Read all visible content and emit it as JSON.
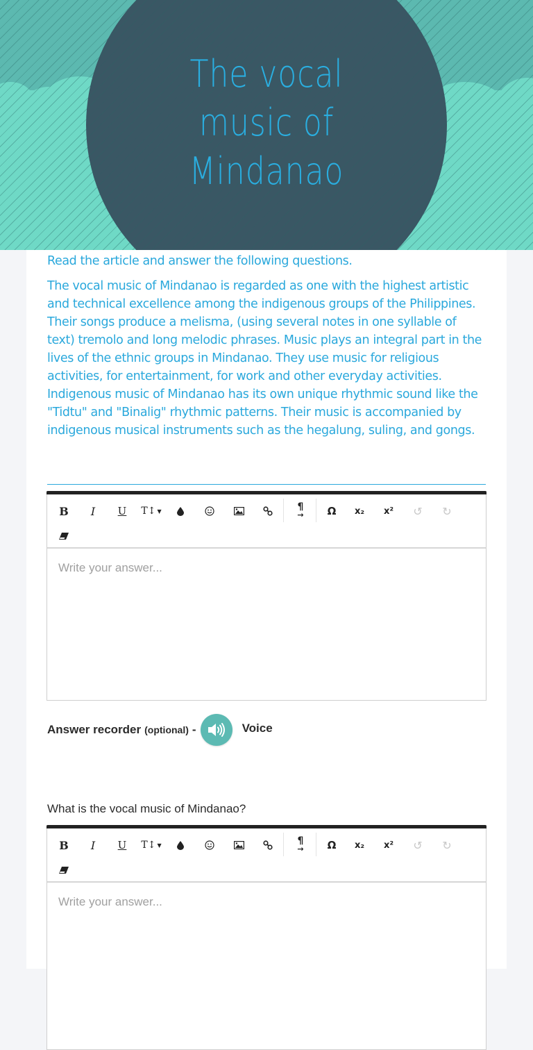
{
  "header": {
    "title_lines": [
      "The vocal",
      "music of",
      "Mindanao"
    ]
  },
  "colors": {
    "banner_teal": "#5cb9b0",
    "cloud_teal": "#6fd9c6",
    "circle_dark": "#3a5764",
    "accent_blue": "#2aa8dc",
    "voice_button": "#5cbab3"
  },
  "instructions": {
    "lead": "Read the article and answer the following questions.",
    "passage": "The vocal music of Mindanao is regarded as one with the highest artistic and technical excellence among the indigenous groups of the Philippines. Their songs produce a melisma, (using several notes in one syllable of text) tremolo and long melodic phrases.  Music plays an integral part in the lives of the ethnic groups in Mindanao. They use music for religious activities, for entertainment, for work and other everyday activities.  Indigenous music of Mindanao has its own unique rhythmic sound like the \"Tidtu\" and \"Binalig\" rhythmic patterns. Their music is accompanied by indigenous musical instruments such as the hegalung, suling, and gongs."
  },
  "toolbar": {
    "bold": "B",
    "italic": "I",
    "underline": "U",
    "text_size": "T↕",
    "omega": "Ω",
    "subscript": "x₂",
    "superscript": "x²",
    "icons": [
      "bold-icon",
      "italic-icon",
      "underline-icon",
      "text-size-icon",
      "color-drop-icon",
      "emoji-icon",
      "image-icon",
      "link-icon",
      "paragraph-direction-icon",
      "special-character-icon",
      "subscript-icon",
      "superscript-icon",
      "undo-icon",
      "redo-icon",
      "clear-format-icon"
    ]
  },
  "answer1": {
    "placeholder": "Write your answer..."
  },
  "recorder": {
    "label": "Answer recorder",
    "optional": "(optional)",
    "dash": "-",
    "voice": "Voice"
  },
  "question1": {
    "text": "What is the vocal music of Mindanao?",
    "placeholder": "Write your answer..."
  }
}
